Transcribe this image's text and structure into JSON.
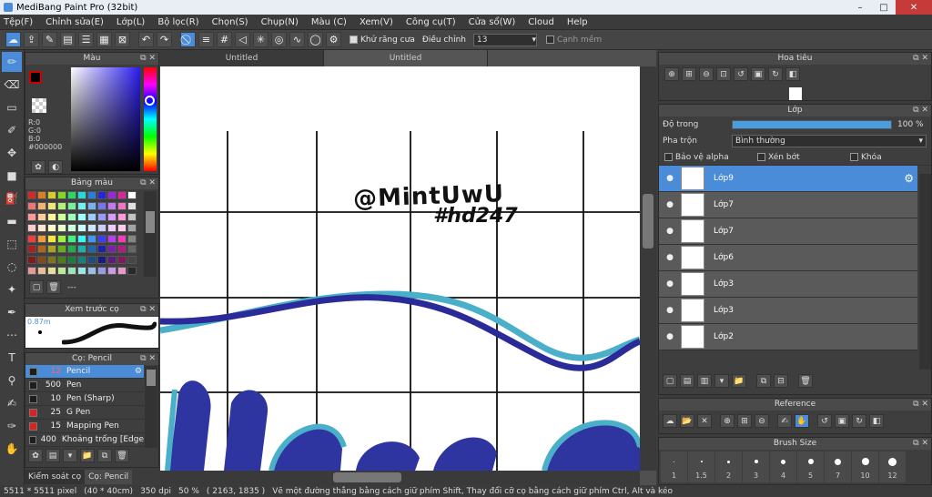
{
  "window": {
    "title": "MediBang Paint Pro (32bit)",
    "min": "–",
    "max": "□",
    "close": "✕"
  },
  "menu": [
    "Tệp(F)",
    "Chỉnh sửa(E)",
    "Lớp(L)",
    "Bộ lọc(R)",
    "Chọn(S)",
    "Chụp(N)",
    "Màu (C)",
    "Xem(V)",
    "Công cụ(T)",
    "Cửa sổ(W)",
    "Cloud",
    "Help"
  ],
  "toolbar": {
    "antialias_label": "Khử răng cưa",
    "adjust_label": "Điều chỉnh",
    "adjust_value": "13",
    "snap_label": "Cạnh mềm"
  },
  "color_panel": {
    "title": "Màu",
    "r": "R:0",
    "g": "G:0",
    "b": "B:0",
    "hex": "#000000"
  },
  "palette_panel": {
    "title": "Bảng màu",
    "more": "---"
  },
  "preview_panel": {
    "title": "Xem trước cọ",
    "size": "0.87m"
  },
  "brush_panel": {
    "title": "Cọ: Pencil",
    "items": [
      {
        "size": "12",
        "name": "Pencil",
        "color": "#1e1e1e"
      },
      {
        "size": "500",
        "name": "Pen",
        "color": "#1e1e1e"
      },
      {
        "size": "10",
        "name": "Pen (Sharp)",
        "color": "#1e1e1e"
      },
      {
        "size": "25",
        "name": "G Pen",
        "color": "#e02020"
      },
      {
        "size": "15",
        "name": "Mapping Pen",
        "color": "#e02020"
      },
      {
        "size": "400",
        "name": "Khoảng trống [Edge",
        "color": "#1e1e1e"
      }
    ]
  },
  "bottom_tabs": [
    "Kiểm soát cọ",
    "Cọ: Pencil"
  ],
  "canvas": {
    "tabs": [
      "Untitled",
      "Untitled"
    ],
    "text_line1": "@MintUwU",
    "text_line2": "#hd247"
  },
  "navigator": {
    "title": "Hoa tiêu"
  },
  "layer_panel": {
    "title": "Lớp",
    "opacity_label": "Độ trong",
    "opacity_value": "100 %",
    "opacity_fraction": 1.0,
    "blend_label": "Pha trộn",
    "blend_value": "Bình thường",
    "protect_alpha": "Bảo vệ alpha",
    "clipping": "Xén bớt",
    "lock": "Khóa",
    "layers": [
      "Lớp9",
      "Lớp7",
      "Lớp7",
      "Lớp6",
      "Lớp3",
      "Lớp3",
      "Lớp2"
    ]
  },
  "reference_panel": {
    "title": "Reference"
  },
  "brush_size_panel": {
    "title": "Brush Size",
    "sizes": [
      "1",
      "1.5",
      "2",
      "3",
      "4",
      "5",
      "7",
      "10",
      "12"
    ]
  },
  "status": {
    "size": "5511 * 5511 pixel",
    "cm": "(40 * 40cm)",
    "dpi": "350 dpi",
    "zoom": "50 %",
    "coords": "( 2163, 1835 )",
    "hint": "Vẽ một đường thẳng bằng cách giữ phím Shift, Thay đổi cỡ cọ bằng cách giữ phím Ctrl, Alt và kéo"
  }
}
